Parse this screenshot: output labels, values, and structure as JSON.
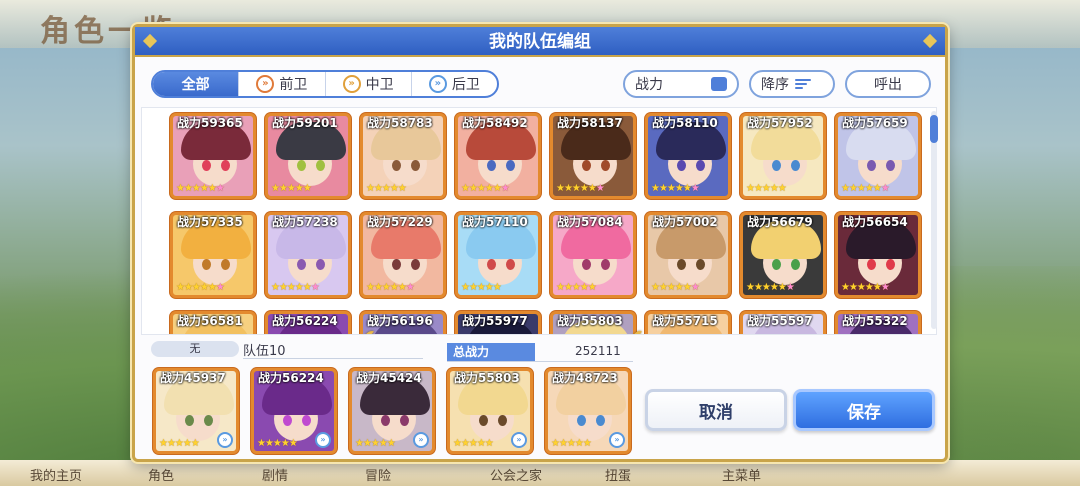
{
  "background": {
    "title": "角色一览",
    "bottom_nav": [
      "我的主页",
      "角色",
      "剧情",
      "冒险",
      "公会之家",
      "扭蛋",
      "主菜单"
    ]
  },
  "dialog": {
    "title": "我的队伍编组",
    "tabs": [
      {
        "label": "全部",
        "icon": "",
        "active": true
      },
      {
        "label": "前卫",
        "icon": "front-icon",
        "active": false
      },
      {
        "label": "中卫",
        "icon": "middle-icon",
        "active": false
      },
      {
        "label": "后卫",
        "icon": "back-icon",
        "active": false
      }
    ],
    "sort_field": "战力",
    "sort_order": "降序",
    "call_label": "呼出"
  },
  "characters": [
    {
      "power": "战力59365",
      "hair": "#7a2a3a",
      "eye": "#e0405a",
      "bg": "#e9a0b8",
      "stars": 5,
      "pink": 1
    },
    {
      "power": "战力59201",
      "hair": "#3a3a44",
      "eye": "#a0c040",
      "bg": "#e88aa0",
      "stars": 5,
      "pink": 0
    },
    {
      "power": "战力58783",
      "hair": "#e8c89a",
      "eye": "#8a5a3a",
      "bg": "#f4d2b8",
      "stars": 5,
      "pink": 0
    },
    {
      "power": "战力58492",
      "hair": "#b84a3a",
      "eye": "#4a6ac0",
      "bg": "#f2b0a0",
      "stars": 5,
      "pink": 1
    },
    {
      "power": "战力58137",
      "hair": "#4a2a1a",
      "eye": "#a04a2a",
      "bg": "#8a5a3a",
      "stars": 5,
      "pink": 1
    },
    {
      "power": "战力58110",
      "hair": "#2a2a5a",
      "eye": "#5a4ab0",
      "bg": "#5a6ac0",
      "stars": 5,
      "pink": 1
    },
    {
      "power": "战力57952",
      "hair": "#f2dc9a",
      "eye": "#4a8ad0",
      "bg": "#f6e8c0",
      "stars": 5,
      "pink": 0
    },
    {
      "power": "战力57659",
      "hair": "#d8dcf0",
      "eye": "#7a5ab0",
      "bg": "#c0c4e8",
      "stars": 5,
      "pink": 1
    },
    {
      "power": "战力57335",
      "hair": "#f2b040",
      "eye": "#c07a2a",
      "bg": "#f6c86a",
      "stars": 5,
      "pink": 1
    },
    {
      "power": "战力57238",
      "hair": "#c8b8e8",
      "eye": "#8a5ab0",
      "bg": "#d8c8f0",
      "stars": 5,
      "pink": 1
    },
    {
      "power": "战力57229",
      "hair": "#e87a6a",
      "eye": "#7a3a3a",
      "bg": "#f2b8a0",
      "stars": 5,
      "pink": 1
    },
    {
      "power": "战力57110",
      "hair": "#8acaf0",
      "eye": "#d04a4a",
      "bg": "#a8dcf6",
      "stars": 5,
      "pink": 0
    },
    {
      "power": "战力57084",
      "hair": "#f06aa0",
      "eye": "#a03a6a",
      "bg": "#f6a8c8",
      "stars": 5,
      "pink": 0
    },
    {
      "power": "战力57002",
      "hair": "#c89a6a",
      "eye": "#6a4a2a",
      "bg": "#e8c8a8",
      "stars": 5,
      "pink": 1
    },
    {
      "power": "战力56679",
      "hair": "#f2d070",
      "eye": "#4aa04a",
      "bg": "#3a3a3a",
      "stars": 5,
      "pink": 1
    },
    {
      "power": "战力56654",
      "hair": "#2a1a2a",
      "eye": "#e03a4a",
      "bg": "#6a2a3a",
      "stars": 5,
      "pink": 1
    },
    {
      "power": "战力56581",
      "hair": "#f2c060",
      "eye": "#c07a2a",
      "bg": "#f6d080",
      "stars": 5,
      "pink": 0
    },
    {
      "power": "战力56224",
      "hair": "#6a2a8a",
      "eye": "#c04ad0",
      "bg": "#8a4ab0",
      "stars": 5,
      "pink": 0
    },
    {
      "power": "战力56196",
      "hair": "#5a4a8a",
      "eye": "#4a4ab0",
      "bg": "#9a8ac8",
      "stars": 5,
      "pink": 0
    },
    {
      "power": "战力55977",
      "hair": "#1a1a3a",
      "eye": "#4a6ad0",
      "bg": "#3a3a6a",
      "stars": 5,
      "pink": 0
    },
    {
      "power": "战力55803",
      "hair": "#f2d890",
      "eye": "#6a4a2a",
      "bg": "#b0a0c0",
      "stars": 5,
      "pink": 0
    },
    {
      "power": "战力55715",
      "hair": "#f0b870",
      "eye": "#8a5a3a",
      "bg": "#f6d0a0",
      "stars": 5,
      "pink": 0
    },
    {
      "power": "战力55597",
      "hair": "#c8b8e0",
      "eye": "#8a6ab0",
      "bg": "#e0d8f0",
      "stars": 5,
      "pink": 0
    },
    {
      "power": "战力55322",
      "hair": "#4a2a6a",
      "eye": "#c04a8a",
      "bg": "#a070c0",
      "stars": 5,
      "pink": 0
    }
  ],
  "team": {
    "tag": "无",
    "name": "队伍10",
    "total_label": "总战力",
    "total_value": "252111",
    "members": [
      {
        "power": "战力45937",
        "hair": "#f2e0b0",
        "eye": "#6a8a4a",
        "bg": "#f6e8c8",
        "stars": 5,
        "pink": 0
      },
      {
        "power": "战力56224",
        "hair": "#6a2a8a",
        "eye": "#c04ad0",
        "bg": "#8a4ab0",
        "stars": 5,
        "pink": 0
      },
      {
        "power": "战力45424",
        "hair": "#3a2a3a",
        "eye": "#8a3a6a",
        "bg": "#c8b8c8",
        "stars": 5,
        "pink": 0
      },
      {
        "power": "战力55803",
        "hair": "#f2d890",
        "eye": "#6a4a2a",
        "bg": "#f6e0b0",
        "stars": 5,
        "pink": 0
      },
      {
        "power": "战力48723",
        "hair": "#f2d0a0",
        "eye": "#4a8ad0",
        "bg": "#f6d8b8",
        "stars": 5,
        "pink": 0
      }
    ]
  },
  "buttons": {
    "cancel": "取消",
    "save": "保存"
  }
}
